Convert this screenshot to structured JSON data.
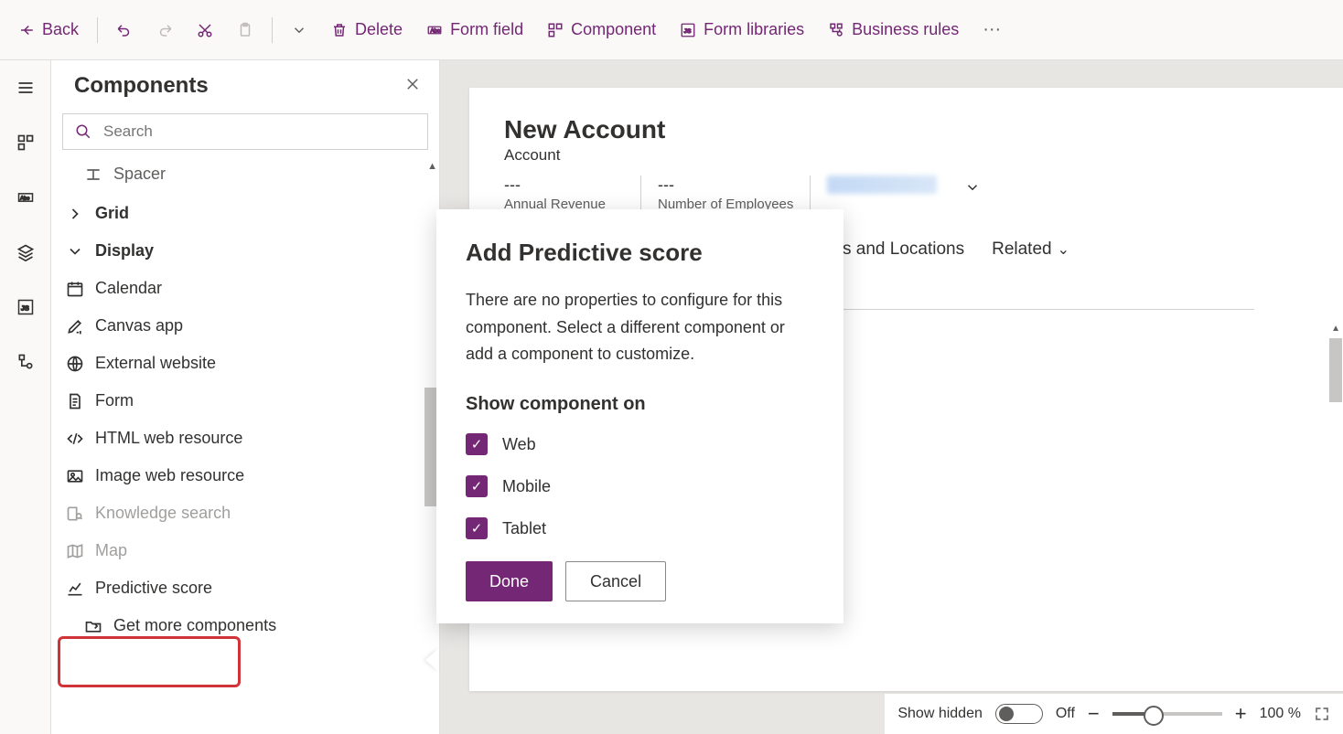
{
  "toolbar": {
    "back": "Back",
    "delete": "Delete",
    "form_field": "Form field",
    "component": "Component",
    "form_libraries": "Form libraries",
    "business_rules": "Business rules"
  },
  "sidebar": {
    "title": "Components",
    "search_placeholder": "Search",
    "items": {
      "spacer": "Spacer",
      "grid": "Grid",
      "display": "Display",
      "calendar": "Calendar",
      "canvas_app": "Canvas app",
      "external_website": "External website",
      "form": "Form",
      "html_web_resource": "HTML web resource",
      "image_web_resource": "Image web resource",
      "knowledge_search": "Knowledge search",
      "map": "Map",
      "predictive_score": "Predictive score",
      "get_more": "Get more components"
    }
  },
  "form": {
    "title": "New Account",
    "subtitle": "Account",
    "fields": {
      "annual_revenue": {
        "value": "---",
        "label": "Annual Revenue"
      },
      "num_employees": {
        "value": "---",
        "label": "Number of Employees"
      }
    },
    "tabs": {
      "addresses": "s and Locations",
      "related": "Related"
    }
  },
  "dialog": {
    "title": "Add Predictive score",
    "body": "There are no properties to configure for this component. Select a different component or add a component to customize.",
    "show_on_label": "Show component on",
    "options": {
      "web": "Web",
      "mobile": "Mobile",
      "tablet": "Tablet"
    },
    "done": "Done",
    "cancel": "Cancel"
  },
  "statusbar": {
    "show_hidden": "Show hidden",
    "off": "Off",
    "zoom": "100 %"
  }
}
